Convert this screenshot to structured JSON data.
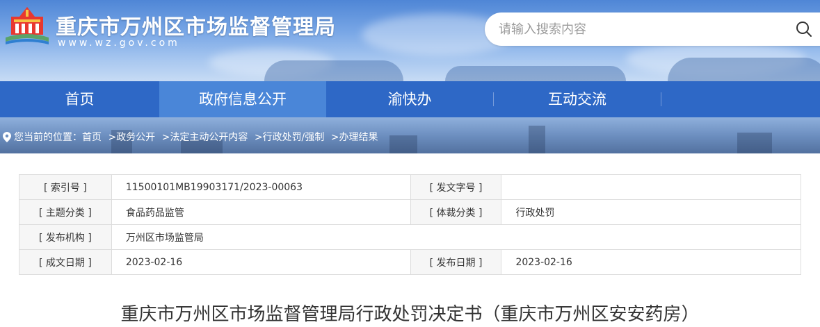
{
  "header": {
    "site_title": "重庆市万州区市场监督管理局",
    "site_url": "www.wz.gov.com",
    "logo_icon": "city-emblem-icon",
    "search": {
      "placeholder": "请输入搜索内容",
      "value": "",
      "icon": "search-icon"
    }
  },
  "nav": {
    "items": [
      {
        "label": "首页",
        "active": false
      },
      {
        "label": "政府信息公开",
        "active": true
      },
      {
        "label": "渝快办",
        "active": false
      },
      {
        "label": "互动交流",
        "active": false
      }
    ]
  },
  "breadcrumb": {
    "prefix": "您当前的位置：",
    "icon": "location-pin-icon",
    "items": [
      "首页",
      ">政务公开",
      ">法定主动公开内容",
      ">行政处罚/强制",
      ">办理结果"
    ]
  },
  "info": {
    "index_no_label": "[ 索引号 ]",
    "index_no": "11500101MB19903171/2023-00063",
    "doc_no_label": "[ 发文字号 ]",
    "doc_no": "",
    "topic_label": "[ 主题分类 ]",
    "topic": "食品药品监管",
    "genre_label": "[ 体裁分类 ]",
    "genre": "行政处罚",
    "issuer_label": "[ 发布机构 ]",
    "issuer": "万州区市场监管局",
    "written_label": "[ 成文日期 ]",
    "written": "2023-02-16",
    "published_label": "[ 发布日期 ]",
    "published": "2023-02-16"
  },
  "article": {
    "title": "重庆市万州区市场监督管理局行政处罚决定书（重庆市万州区安安药房）"
  },
  "colors": {
    "nav_bg": "#2e68c6",
    "nav_active": "#4a86d8",
    "table_border": "#dcdcdc",
    "label_bg": "#f6f6f6"
  }
}
